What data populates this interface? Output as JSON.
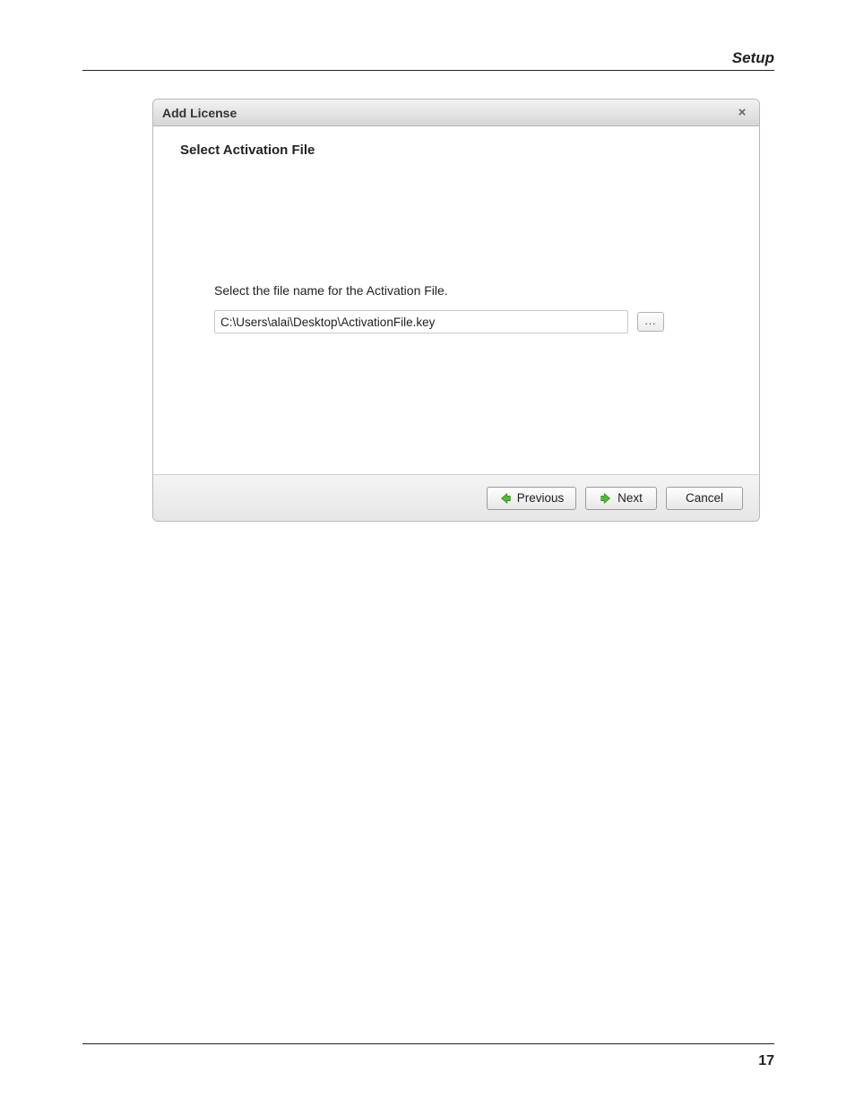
{
  "page": {
    "header_label": "Setup",
    "page_number": "17"
  },
  "dialog": {
    "title": "Add License",
    "close_glyph": "×",
    "section_heading": "Select Activation File",
    "instruction": "Select the file name for the Activation File.",
    "file_path": "C:\\Users\\alai\\Desktop\\ActivationFile.key",
    "browse_label": "...",
    "buttons": {
      "previous": "Previous",
      "next": "Next",
      "cancel": "Cancel"
    }
  }
}
